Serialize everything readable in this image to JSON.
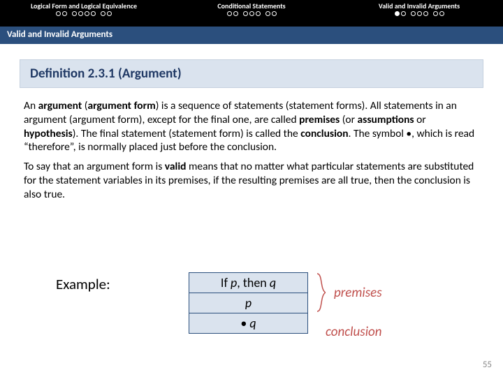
{
  "nav": {
    "sections": [
      {
        "label": "Logical Form and Logical Equivalence",
        "dots": [
          [
            0,
            0
          ],
          [
            0,
            0,
            0,
            0
          ],
          [
            0,
            0
          ]
        ],
        "fill": []
      },
      {
        "label": "Conditional Statements",
        "dots": [
          [
            0,
            0
          ],
          [
            0,
            0,
            0
          ],
          [
            0,
            0
          ]
        ],
        "fill": []
      },
      {
        "label": "Valid and Invalid Arguments",
        "dots": [
          [
            1,
            0
          ],
          [
            0,
            0,
            0
          ],
          [
            0,
            0
          ]
        ],
        "fill": [
          0
        ]
      }
    ]
  },
  "subheader": "Valid and Invalid Arguments",
  "definition_title": "Definition 2.3.1 (Argument)",
  "body_html_1a": "An ",
  "body_html_1b": "argument",
  "body_html_1c": " (",
  "body_html_1d": "argument form",
  "body_html_1e": ") is a sequence of statements (statement forms). All statements in an argument (argument form), except for the final one, are called ",
  "body_html_1f": "premises",
  "body_html_1g": " (or ",
  "body_html_1h": "assumptions",
  "body_html_1i": " or ",
  "body_html_1j": "hypothesis",
  "body_html_1k": "). The final statement (statement form) is called the ",
  "body_html_1l": "conclusion",
  "body_html_1m": ". The symbol •, which is read “therefore”, is normally placed just before the conclusion.",
  "body_html_2a": "To say that an argument form is ",
  "body_html_2b": "valid",
  "body_html_2c": " means that no matter what particular statements are substituted for the statement variables in its premises, if the resulting premises are all true, then the conclusion is also true.",
  "example_label": "Example:",
  "table": {
    "r1_pre": "If ",
    "r1_p": "p",
    "r1_mid": ", then ",
    "r1_q": "q",
    "r2": "p",
    "r3_sym": "• ",
    "r3_q": "q"
  },
  "ann_premises": "premises",
  "ann_conclusion": "conclusion",
  "page_number": "55"
}
